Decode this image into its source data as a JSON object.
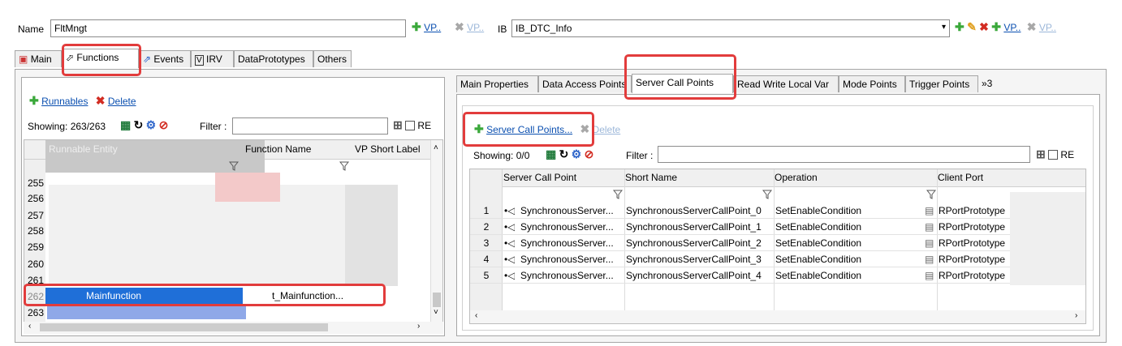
{
  "top": {
    "name_label": "Name",
    "name_value": "FltMngt",
    "vp_link": "VP..",
    "vp_link_disabled": "VP..",
    "ib_label": "IB",
    "ib_value": "IB_DTC_Info",
    "ib_vp_link": "VP..",
    "ib_vp_link_disabled": "VP.."
  },
  "tabs": [
    {
      "label": "Main"
    },
    {
      "label": "Functions"
    },
    {
      "label": "Events"
    },
    {
      "label": "IRV"
    },
    {
      "label": "DataPrototypes"
    },
    {
      "label": "Others"
    }
  ],
  "left": {
    "runnables_link": "Runnables",
    "delete_link": "Delete",
    "showing": "Showing: 263/263",
    "filter_label": "Filter :",
    "re_label": "RE",
    "columns": [
      "Runnable Entity",
      "Function Name",
      "VP Short Label"
    ],
    "row_numbers": [
      "255",
      "256",
      "257",
      "258",
      "259",
      "260",
      "261",
      "262",
      "263"
    ],
    "selected_row": {
      "runnable": "Mainfunction",
      "function": "t_Mainfunction..."
    }
  },
  "right": {
    "tabs": [
      "Main Properties",
      "Data Access Points",
      "Server Call Points",
      "Read Write Local Var",
      "Mode Points",
      "Trigger Points",
      "»3"
    ],
    "add_link": "Server Call Points...",
    "delete_link": "Delete",
    "showing": "Showing: 0/0",
    "filter_label": "Filter :",
    "re_label": "RE",
    "columns": [
      "Server Call Point",
      "Short Name",
      "Operation",
      "Client Port"
    ],
    "rows": [
      {
        "n": "1",
        "scp": "SynchronousServer...",
        "short": "SynchronousServerCallPoint_0",
        "op": "SetEnableCondition",
        "port": "RPortPrototype"
      },
      {
        "n": "2",
        "scp": "SynchronousServer...",
        "short": "SynchronousServerCallPoint_1",
        "op": "SetEnableCondition",
        "port": "RPortPrototype"
      },
      {
        "n": "3",
        "scp": "SynchronousServer...",
        "short": "SynchronousServerCallPoint_2",
        "op": "SetEnableCondition",
        "port": "RPortPrototype"
      },
      {
        "n": "4",
        "scp": "SynchronousServer...",
        "short": "SynchronousServerCallPoint_3",
        "op": "SetEnableCondition",
        "port": "RPortPrototype"
      },
      {
        "n": "5",
        "scp": "SynchronousServer...",
        "short": "SynchronousServerCallPoint_4",
        "op": "SetEnableCondition",
        "port": "RPortPrototype"
      }
    ]
  },
  "colors": {
    "highlight": "#e23c3c",
    "selection": "#1f6fd8",
    "link": "#0a4fb0"
  }
}
